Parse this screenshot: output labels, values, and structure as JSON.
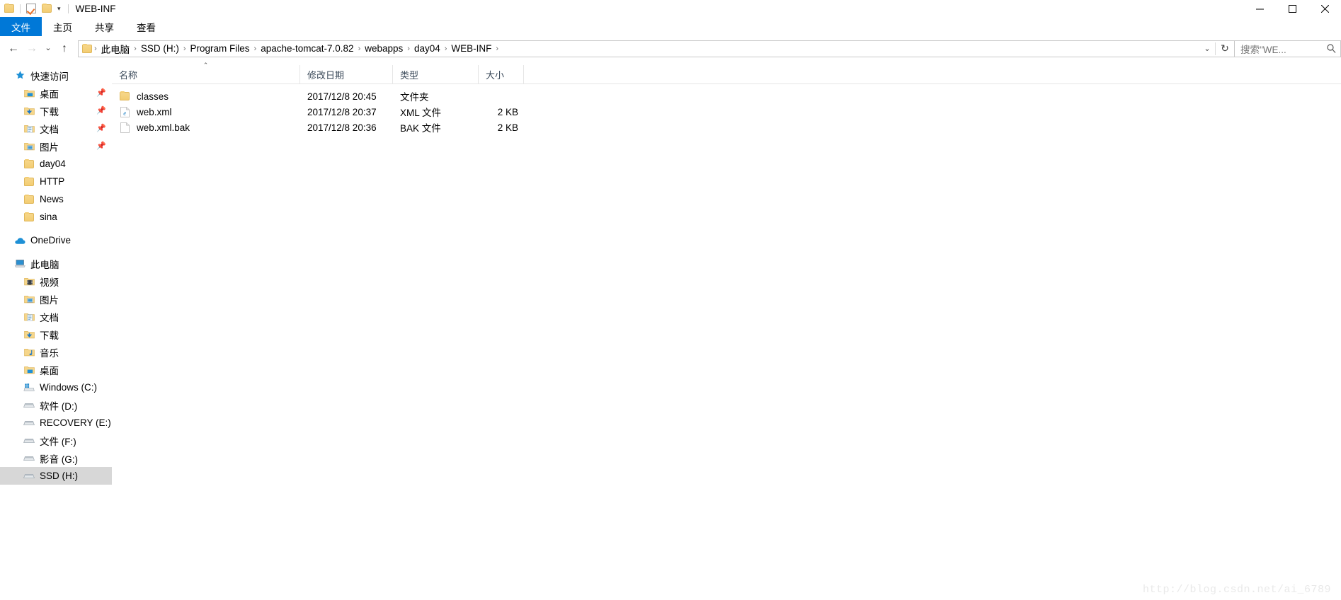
{
  "window": {
    "title": "WEB-INF",
    "quick_access_toolbar": [
      {
        "name": "folder-icon",
        "label": "属性"
      },
      {
        "name": "properties-icon",
        "label": "属性"
      },
      {
        "name": "new-folder-icon",
        "label": "新建文件夹"
      },
      {
        "name": "chevron-down-icon",
        "label": "自定义快速访问工具栏"
      }
    ],
    "controls": {
      "minimize": "最小化",
      "maximize": "最大化",
      "close": "关闭"
    }
  },
  "ribbon": {
    "tabs": [
      {
        "label": "文件",
        "active": true
      },
      {
        "label": "主页",
        "active": false
      },
      {
        "label": "共享",
        "active": false
      },
      {
        "label": "查看",
        "active": false
      }
    ]
  },
  "navbar": {
    "back": "返回",
    "forward": "前进",
    "recent": "最近浏览的位置",
    "up": "上移到",
    "breadcrumbs": [
      "此电脑",
      "SSD (H:)",
      "Program Files",
      "apache-tomcat-7.0.82",
      "webapps",
      "day04",
      "WEB-INF"
    ],
    "separator": "›",
    "dropdown": "⌄",
    "refresh": "↻",
    "refresh_title": "刷新"
  },
  "search": {
    "placeholder": "搜索\"WE...",
    "icon": "search-icon"
  },
  "sidebar": {
    "sections": [
      {
        "name": "quick-access",
        "label": "快速访问",
        "icon": "star-icon",
        "items": [
          {
            "label": "桌面",
            "icon": "desktop-folder-icon",
            "pinned": true
          },
          {
            "label": "下载",
            "icon": "downloads-folder-icon",
            "pinned": true
          },
          {
            "label": "文档",
            "icon": "documents-folder-icon",
            "pinned": true
          },
          {
            "label": "图片",
            "icon": "pictures-folder-icon",
            "pinned": true
          },
          {
            "label": "day04",
            "icon": "folder-icon",
            "pinned": false
          },
          {
            "label": "HTTP",
            "icon": "folder-icon",
            "pinned": false
          },
          {
            "label": "News",
            "icon": "folder-icon",
            "pinned": false
          },
          {
            "label": "sina",
            "icon": "folder-icon",
            "pinned": false
          }
        ]
      },
      {
        "name": "onedrive",
        "label": "OneDrive",
        "icon": "cloud-icon",
        "items": []
      },
      {
        "name": "this-pc",
        "label": "此电脑",
        "icon": "computer-icon",
        "items": [
          {
            "label": "视频",
            "icon": "videos-folder-icon",
            "selected": false
          },
          {
            "label": "图片",
            "icon": "pictures-folder-icon",
            "selected": false
          },
          {
            "label": "文档",
            "icon": "documents-folder-icon",
            "selected": false
          },
          {
            "label": "下载",
            "icon": "downloads-folder-icon",
            "selected": false
          },
          {
            "label": "音乐",
            "icon": "music-folder-icon",
            "selected": false
          },
          {
            "label": "桌面",
            "icon": "desktop-folder-icon",
            "selected": false
          },
          {
            "label": "Windows (C:)",
            "icon": "windows-drive-icon",
            "selected": false
          },
          {
            "label": "软件 (D:)",
            "icon": "drive-icon",
            "selected": false
          },
          {
            "label": "RECOVERY (E:)",
            "icon": "drive-icon",
            "selected": false
          },
          {
            "label": "文件 (F:)",
            "icon": "drive-icon",
            "selected": false
          },
          {
            "label": "影音 (G:)",
            "icon": "drive-icon",
            "selected": false
          },
          {
            "label": "SSD (H:)",
            "icon": "drive-icon",
            "selected": true
          }
        ]
      }
    ]
  },
  "filelist": {
    "columns": [
      {
        "label": "名称",
        "key": "name",
        "sorted": true,
        "sort_direction": "asc"
      },
      {
        "label": "修改日期",
        "key": "date"
      },
      {
        "label": "类型",
        "key": "type"
      },
      {
        "label": "大小",
        "key": "size"
      }
    ],
    "rows": [
      {
        "name": "classes",
        "date": "2017/12/8 20:45",
        "type": "文件夹",
        "size": "",
        "icon": "folder-icon"
      },
      {
        "name": "web.xml",
        "date": "2017/12/8 20:37",
        "type": "XML 文件",
        "size": "2 KB",
        "icon": "xml-file-icon"
      },
      {
        "name": "web.xml.bak",
        "date": "2017/12/8 20:36",
        "type": "BAK 文件",
        "size": "2 KB",
        "icon": "generic-file-icon"
      }
    ]
  },
  "watermark": {
    "text": "http://blog.csdn.net/ai_6789"
  },
  "colors": {
    "accent": "#0078d7",
    "folder": "#f3cd72",
    "header_text": "#3b4a5a",
    "selection": "#d7d7d7"
  }
}
